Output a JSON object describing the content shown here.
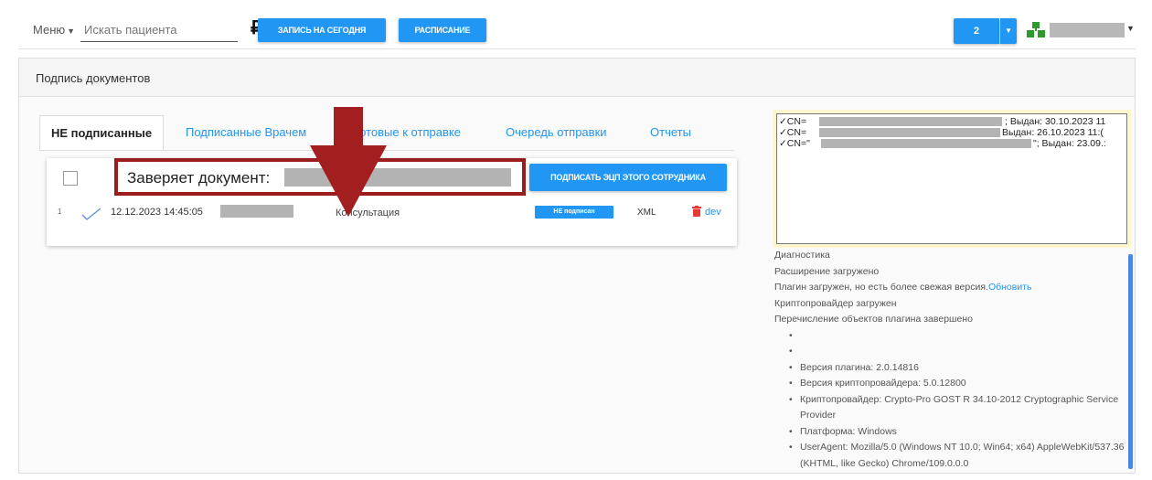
{
  "topbar": {
    "menu_label": "Меню",
    "search_placeholder": "Искать пациента",
    "currency_symbol": "₽",
    "btn_today": "ЗАПИСЬ НА СЕГОДНЯ",
    "btn_schedule": "РАСПИСАНИЕ",
    "counter": "2",
    "accent_color": "#2196f3"
  },
  "panel": {
    "title": "Подпись документов"
  },
  "tabs": [
    {
      "label": "НЕ подписанные",
      "active": true
    },
    {
      "label": "Подписанные Врачем",
      "active": false
    },
    {
      "label": "Готовые к отправке",
      "active": false
    },
    {
      "label": "Очередь отправки",
      "active": false
    },
    {
      "label": "Отчеты",
      "active": false
    }
  ],
  "card": {
    "certifies_label": "Заверяет документ:",
    "sign_button": "ПОДПИСАТЬ ЭЦП ЭТОГО СОТРУДНИКА",
    "row": {
      "number": "1",
      "datetime": "12.12.2023 14:45:05",
      "type": "Консультация",
      "status": "НЕ подписан",
      "format": "XML",
      "dev_link": "dev"
    }
  },
  "certificates": [
    {
      "prefix": "✓CN=",
      "issued": "; Выдан: 30.10.2023 11"
    },
    {
      "prefix": "✓CN=",
      "issued": "Выдан: 26.10.2023 11:("
    },
    {
      "prefix": "✓CN=\"",
      "issued": "\"; Выдан: 23.09.:"
    }
  ],
  "diagnostics": {
    "title": "Диагностика",
    "lines": [
      "Расширение загружено",
      "Плагин загружен, но есть более свежая версия.",
      "Криптопровайдер загружен",
      "Перечисление объектов плагина завершено"
    ],
    "update_link": "Обновить",
    "items": [
      "",
      "",
      "Версия плагина: 2.0.14816",
      "Версия криптопровайдера: 5.0.12800",
      "Криптопровайдер: Crypto-Pro GOST R 34.10-2012 Cryptographic Service Provider",
      "Платформа: Windows",
      "UserAgent: Mozilla/5.0 (Windows NT 10.0; Win64; x64) AppleWebKit/537.36 (KHTML, like Gecko) Chrome/109.0.0.0"
    ]
  },
  "annotation": {
    "arrow_color": "#a31f1f",
    "highlight_color": "#9b1c1c"
  }
}
